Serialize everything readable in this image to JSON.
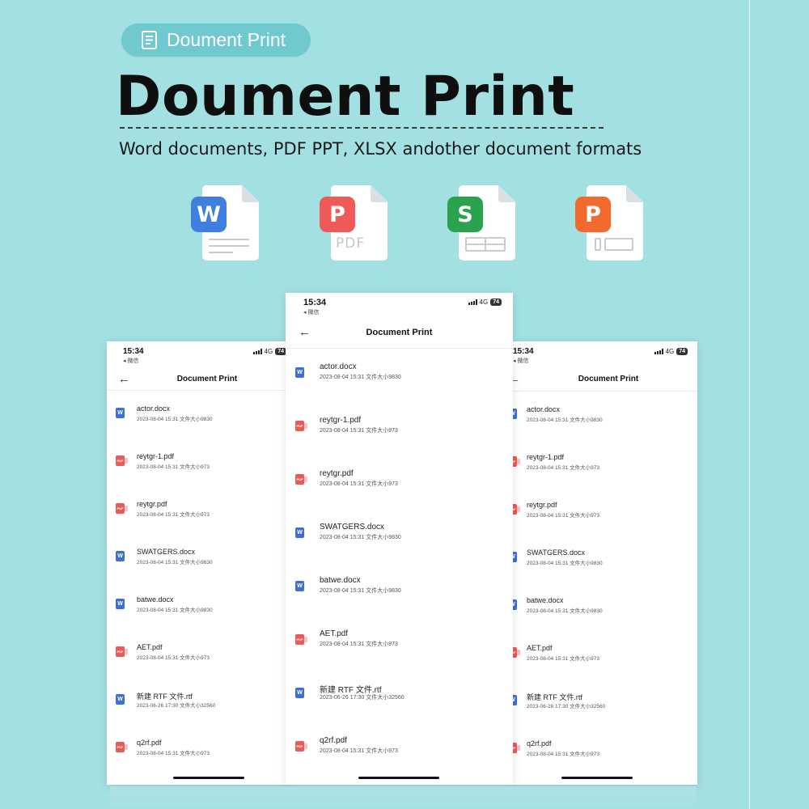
{
  "header": {
    "pill_label": "Doument Print",
    "title": "Doument Print",
    "subtitle": "Word documents, PDF PPT, XLSX andother document formats"
  },
  "file_types": [
    {
      "name": "word",
      "letter": "W",
      "color": "#3f7fe0",
      "label": ""
    },
    {
      "name": "pdf",
      "letter": "P",
      "color": "#ef5a58",
      "label": "PDF"
    },
    {
      "name": "sheet",
      "letter": "S",
      "color": "#2ba34e",
      "label": ""
    },
    {
      "name": "slides",
      "letter": "P",
      "color": "#f26a2e",
      "label": ""
    }
  ],
  "phone": {
    "time": "15:34",
    "back_app": "◂ 微信",
    "network": "4G",
    "battery": "74",
    "nav_title": "Document Print",
    "back_glyph": "←"
  },
  "files": [
    {
      "name": "actor.docx",
      "meta": "2023-08-04 15:31  文件大小9830",
      "type": "w"
    },
    {
      "name": "reytgr-1.pdf",
      "meta": "2023-08-04 15:31  文件大小973",
      "type": "p"
    },
    {
      "name": "reytgr.pdf",
      "meta": "2023-08-04 15:31  文件大小973",
      "type": "p"
    },
    {
      "name": "SWATGERS.docx",
      "meta": "2023-08-04 15:31  文件大小9830",
      "type": "w"
    },
    {
      "name": "batwe.docx",
      "meta": "2023-08-04 15:31  文件大小9830",
      "type": "w"
    },
    {
      "name": "AET.pdf",
      "meta": "2023-08-04 15:31  文件大小973",
      "type": "p"
    },
    {
      "name": "新建 RTF 文件.rtf",
      "meta": "2023-06-26 17:30  文件大小32560",
      "type": "w"
    },
    {
      "name": "q2rf.pdf",
      "meta": "2023-08-04 15:31  文件大小973",
      "type": "p"
    }
  ],
  "colors": {
    "background": "#a3e0e2",
    "pill": "#6fc9cf",
    "word": "#3f6fd6",
    "pdf": "#ea5a57"
  }
}
